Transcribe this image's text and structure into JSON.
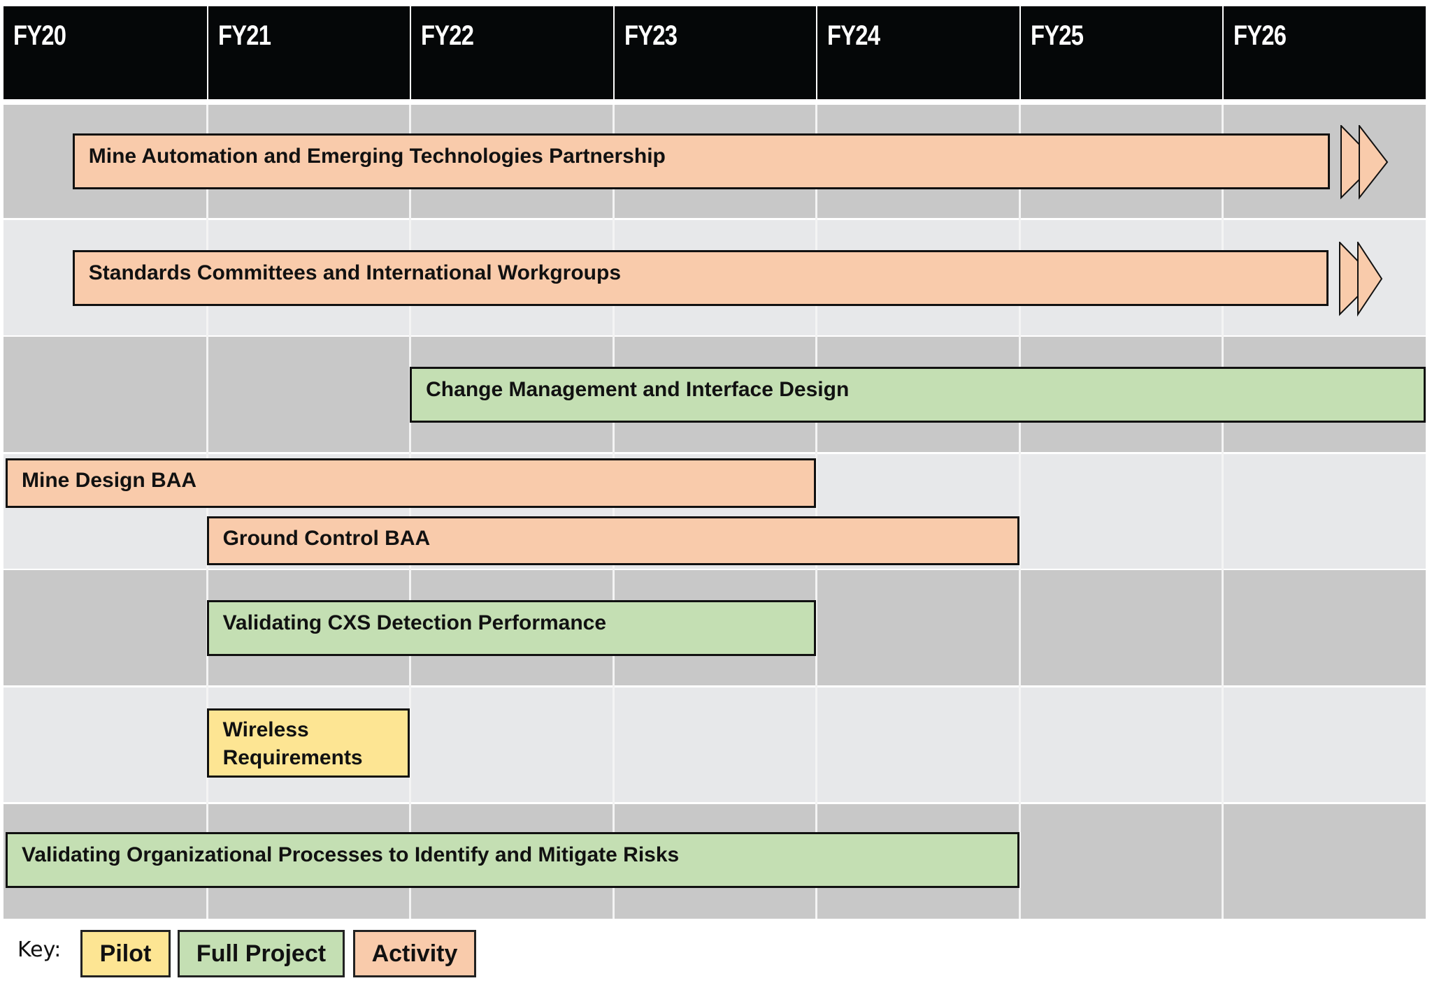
{
  "chart_data": {
    "type": "gantt",
    "title": "",
    "fiscal_years": [
      "FY20",
      "FY21",
      "FY22",
      "FY23",
      "FY24",
      "FY25",
      "FY26"
    ],
    "x_unit": "fiscal year (0 = start of FY20)",
    "xlim": [
      0,
      7
    ],
    "rows": 7,
    "tasks": [
      {
        "name": "Mine Automation and Emerging Technologies Partnership",
        "category": "Activity",
        "start": 0.34,
        "end": 6.53,
        "ongoing": true,
        "row": 0
      },
      {
        "name": "Standards Committees and International Workgroups",
        "category": "Activity",
        "start": 0.34,
        "end": 6.52,
        "ongoing": true,
        "row": 1
      },
      {
        "name": "Change Management and Interface Design",
        "category": "Full Project",
        "start": 2.0,
        "end": 7.0,
        "ongoing": false,
        "row": 2
      },
      {
        "name": "Mine Design BAA",
        "category": "Activity",
        "start": 0.0,
        "end": 4.0,
        "ongoing": false,
        "row": 3,
        "lane": 0
      },
      {
        "name": "Ground Control BAA",
        "category": "Activity",
        "start": 1.0,
        "end": 5.0,
        "ongoing": false,
        "row": 3,
        "lane": 1
      },
      {
        "name": "Validating CXS Detection Performance",
        "category": "Full Project",
        "start": 1.0,
        "end": 4.0,
        "ongoing": false,
        "row": 4
      },
      {
        "name": "Wireless\nRequirements",
        "category": "Pilot",
        "start": 1.0,
        "end": 2.0,
        "ongoing": false,
        "row": 5
      },
      {
        "name": "Validating Organizational Processes to Identify and Mitigate Risks",
        "category": "Full Project",
        "start": 0.0,
        "end": 5.0,
        "ongoing": false,
        "row": 6
      }
    ],
    "legend": {
      "title": "Key:",
      "placement": "bottom-left",
      "items": [
        {
          "label": "Pilot",
          "color": "#fde593"
        },
        {
          "label": "Full Project",
          "color": "#c4dfb3"
        },
        {
          "label": "Activity",
          "color": "#f9cbab"
        }
      ]
    },
    "colors": {
      "Pilot": "#fde593",
      "Full Project": "#c4dfb3",
      "Activity": "#f9cbab",
      "header_bg": "#050708",
      "row_dark": "#c8c8c8",
      "row_light": "#e7e8ea"
    }
  }
}
